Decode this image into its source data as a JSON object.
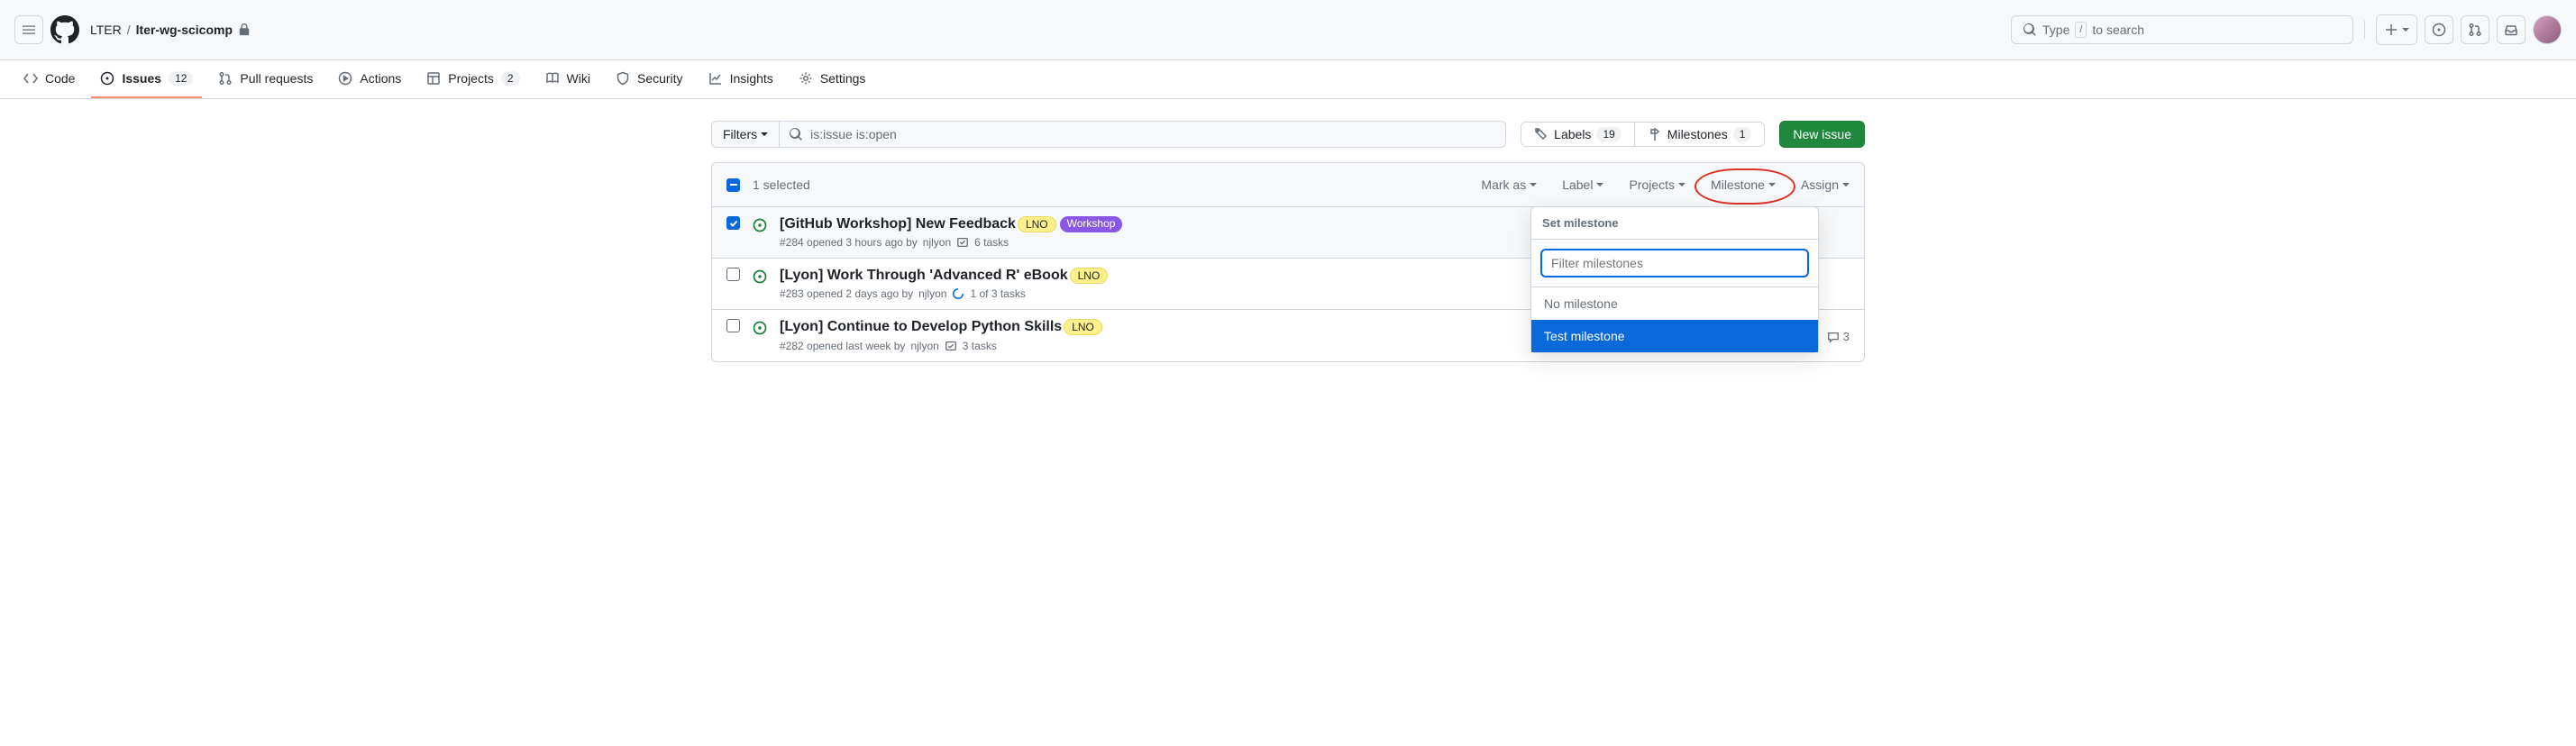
{
  "header": {
    "owner": "LTER",
    "repo": "lter-wg-scicomp",
    "search_placeholder": "Type",
    "search_suffix": "to search"
  },
  "tabs": {
    "code": "Code",
    "issues": "Issues",
    "issues_count": "12",
    "pulls": "Pull requests",
    "actions": "Actions",
    "projects": "Projects",
    "projects_count": "2",
    "wiki": "Wiki",
    "security": "Security",
    "insights": "Insights",
    "settings": "Settings"
  },
  "toolbar": {
    "filters": "Filters",
    "query": "is:issue is:open",
    "labels": "Labels",
    "labels_count": "19",
    "milestones": "Milestones",
    "milestones_count": "1",
    "new_issue": "New issue"
  },
  "list_header": {
    "selected": "1 selected",
    "mark_as": "Mark as",
    "label": "Label",
    "projects": "Projects",
    "milestone": "Milestone",
    "assign": "Assign"
  },
  "popup": {
    "title": "Set milestone",
    "filter_placeholder": "Filter milestones",
    "none": "No milestone",
    "test": "Test milestone"
  },
  "issues": [
    {
      "title": "[GitHub Workshop] New Feedback",
      "labels": [
        {
          "text": "LNO",
          "cls": "lno"
        },
        {
          "text": "Workshop",
          "cls": "workshop"
        }
      ],
      "num": "#284",
      "opened": "opened 3 hours ago by",
      "author": "njlyon",
      "tasks_type": "check",
      "tasks": "6 tasks",
      "selected": true
    },
    {
      "title": "[Lyon] Work Through 'Advanced R' eBook",
      "labels": [
        {
          "text": "LNO",
          "cls": "lno"
        }
      ],
      "num": "#283",
      "opened": "opened 2 days ago by",
      "author": "njlyon",
      "tasks_type": "progress",
      "tasks": "1 of 3 tasks",
      "selected": false
    },
    {
      "title": "[Lyon] Continue to Develop Python Skills",
      "labels": [
        {
          "text": "LNO",
          "cls": "lno"
        }
      ],
      "num": "#282",
      "opened": "opened last week by",
      "author": "njlyon",
      "tasks_type": "check",
      "tasks": "3 tasks",
      "selected": false,
      "comments": "3",
      "has_assignee": true
    }
  ]
}
